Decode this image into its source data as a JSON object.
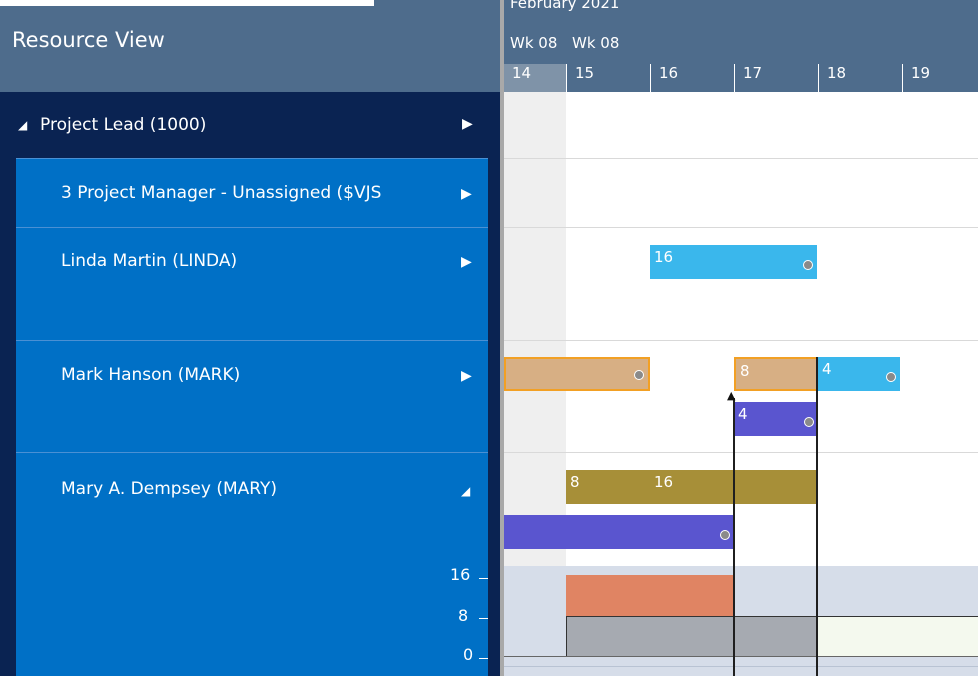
{
  "panel": {
    "title": "Resource View"
  },
  "timeline": {
    "month": "February 2021",
    "weeks": [
      "Wk 08",
      "Wk 08"
    ],
    "days": [
      "14",
      "15",
      "16",
      "17",
      "18",
      "19"
    ]
  },
  "rows": {
    "lead": {
      "label": "Project Lead (1000)",
      "arrow": "◢"
    },
    "pm": {
      "label": "3 Project Manager - Unassigned ($VJS",
      "arrow": "▶"
    },
    "linda": {
      "label": "Linda Martin (LINDA)",
      "arrow": "▶"
    },
    "mark": {
      "label": "Mark Hanson (MARK)",
      "arrow": "▶"
    },
    "mary": {
      "label": "Mary A. Dempsey (MARY)",
      "arrow": "◢"
    }
  },
  "bars": {
    "linda1": "16",
    "mark_a": "",
    "mark_b": "8",
    "mark_c": "4",
    "mark_d": "4",
    "mary_a": "8",
    "mary_b": "16",
    "mary_c": ""
  },
  "histogram": {
    "axis_labels": [
      "16",
      "8",
      "0"
    ],
    "levels_hours": {
      "scheduled_15_17": 16,
      "capacity": 8
    }
  },
  "colors": {
    "header": "#4e6c8c",
    "panel_dark": "#0a2352",
    "row_blue": "#0070c6",
    "bar_light_blue": "#3ab7ec",
    "bar_tan": "#d7af84",
    "bar_purple": "#5a55cf",
    "bar_olive": "#a78f38",
    "hist_orange": "#e08463",
    "hist_gray": "#a6aab1"
  }
}
